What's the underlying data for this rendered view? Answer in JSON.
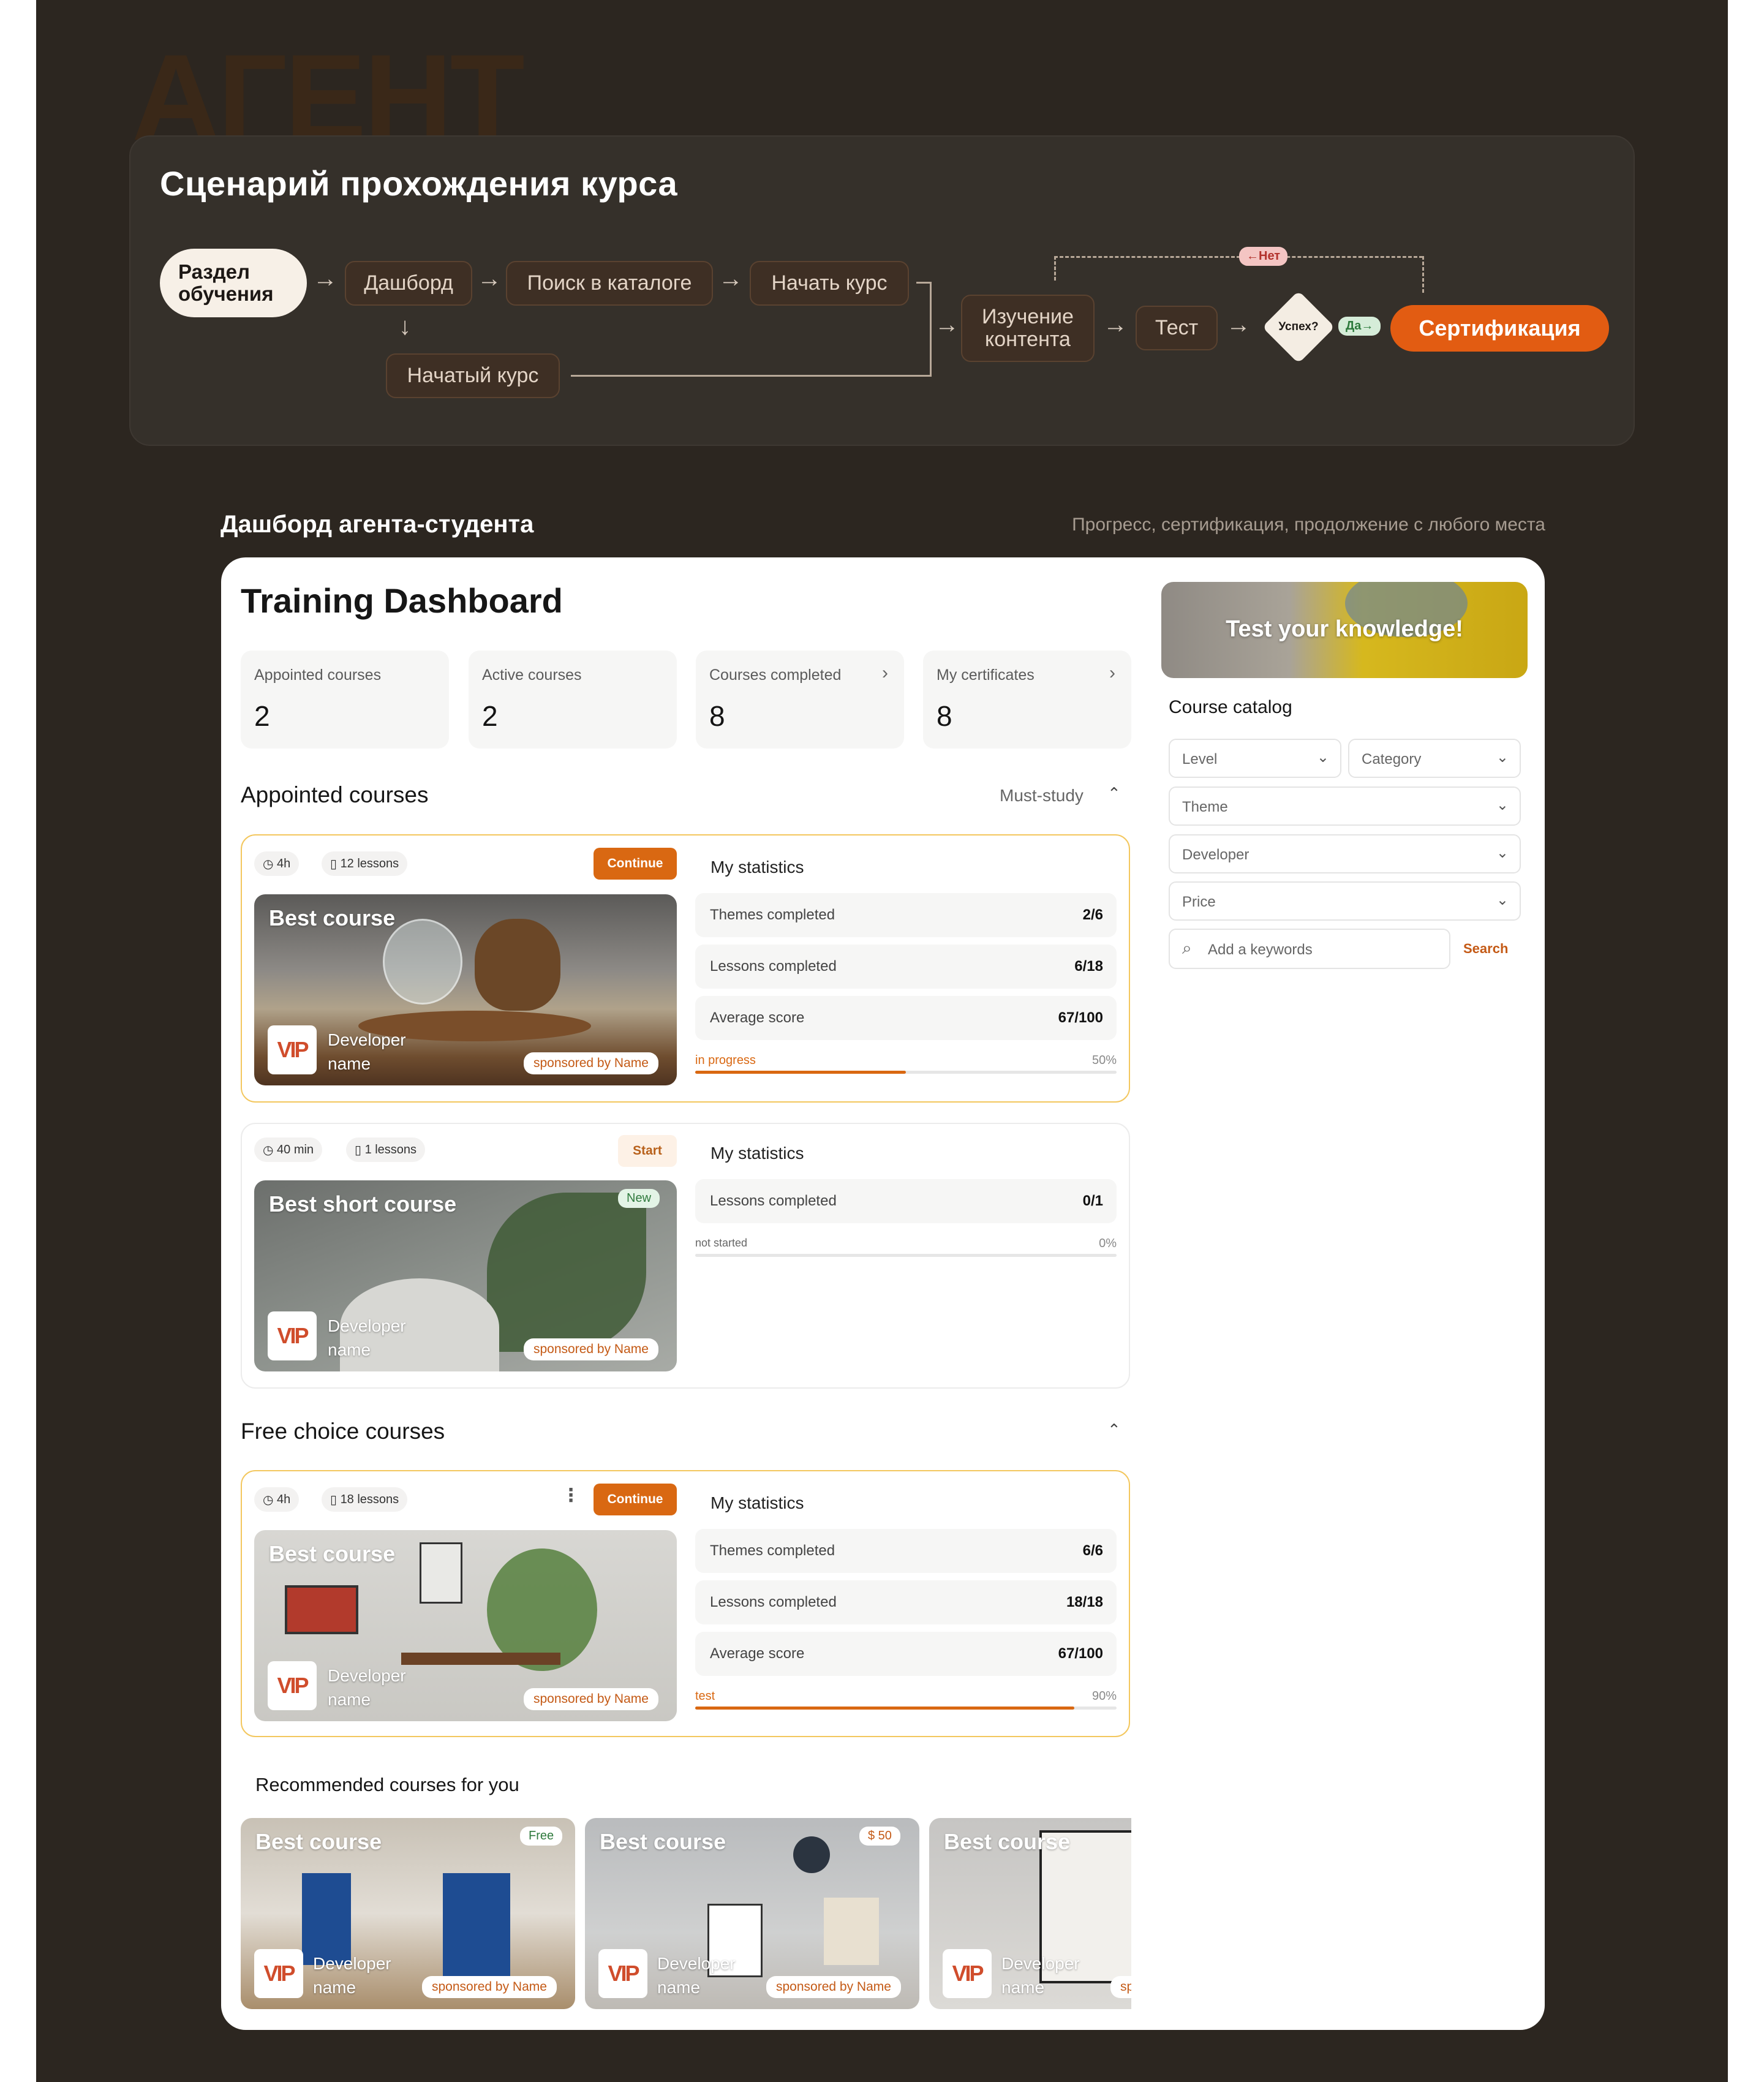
{
  "ghost_text": "АГЕНТ",
  "scenario": {
    "title": "Сценарий прохождения курса",
    "nodes": {
      "start": "Раздел обучения",
      "dashboard": "Дашборд",
      "catalog_search": "Поиск в каталоге",
      "start_course": "Начать курс",
      "started_course": "Начатый курс",
      "study_content": "Изучение контента",
      "test": "Тест",
      "success": "Успех?",
      "certification": "Сертификация"
    },
    "branch_no": "Нет",
    "branch_yes": "Да"
  },
  "section": {
    "title": "Дашборд агента-студента",
    "subtitle": "Прогресс, сертификация, продолжение с любого места"
  },
  "dashboard": {
    "title": "Training Dashboard",
    "stats": [
      {
        "label": "Appointed courses",
        "value": "2"
      },
      {
        "label": "Active courses",
        "value": "2"
      },
      {
        "label": "Courses completed",
        "value": "8"
      },
      {
        "label": "My certificates",
        "value": "8"
      }
    ],
    "appointed": {
      "title": "Appointed courses",
      "filter": "Must-study",
      "courses": [
        {
          "duration": "4h",
          "lessons": "12 lessons",
          "action": "Continue",
          "title": "Best course",
          "developer": "Developer name",
          "sponsor": "sponsored by Name",
          "stats_title": "My statistics",
          "rows": [
            {
              "k": "Themes completed",
              "v": "2/6"
            },
            {
              "k": "Lessons completed",
              "v": "6/18"
            },
            {
              "k": "Average score",
              "v": "67/100"
            }
          ],
          "status": "in progress",
          "percent_label": "50%",
          "progress": 0.5
        },
        {
          "duration": "40 min",
          "lessons": "1 lessons",
          "action": "Start",
          "title": "Best short course",
          "badge": "New",
          "developer": "Developer name",
          "sponsor": "sponsored by Name",
          "stats_title": "My statistics",
          "rows": [
            {
              "k": "Lessons completed",
              "v": "0/1"
            }
          ],
          "status": "not started",
          "percent_label": "0%",
          "progress": 0
        }
      ]
    },
    "free": {
      "title": "Free choice courses",
      "courses": [
        {
          "duration": "4h",
          "lessons": "18 lessons",
          "action": "Continue",
          "title": "Best course",
          "developer": "Developer name",
          "sponsor": "sponsored by Name",
          "stats_title": "My statistics",
          "rows": [
            {
              "k": "Themes completed",
              "v": "6/6"
            },
            {
              "k": "Lessons completed",
              "v": "18/18"
            },
            {
              "k": "Average score",
              "v": "67/100"
            }
          ],
          "status": "test",
          "percent_label": "90%",
          "progress": 0.9
        }
      ]
    },
    "recommended": {
      "title": "Recommended courses for you",
      "cards": [
        {
          "title": "Best course",
          "tag": "Free",
          "developer": "Developer name",
          "sponsor": "sponsored by Name"
        },
        {
          "title": "Best course",
          "tag": "$ 50",
          "developer": "Developer name",
          "sponsor": "sponsored by Name"
        },
        {
          "title": "Best course",
          "developer": "Developer name",
          "sponsor": "sp"
        }
      ]
    },
    "logo_text": "VIP",
    "side": {
      "banner": "Test your knowledge!",
      "catalog_title": "Course catalog",
      "filters": {
        "level": "Level",
        "category": "Category",
        "theme": "Theme",
        "developer": "Developer",
        "price": "Price"
      },
      "keywords_placeholder": "Add a keywords",
      "search_label": "Search"
    }
  },
  "colors": {
    "accent": "#d96812",
    "dark_bg": "#2c2620",
    "panel": "#35302a",
    "cert": "#e25c12"
  }
}
